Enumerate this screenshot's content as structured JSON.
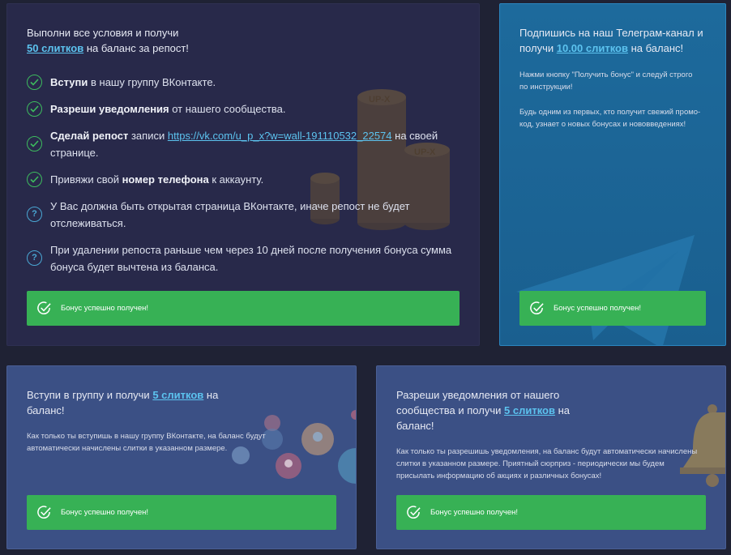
{
  "main": {
    "head_pre": "Выполни все условия и получи",
    "head_link": "50 слитков",
    "head_post": "на баланс за репост!",
    "coin_label_1": "UP-X",
    "coin_label_2": "UP-X",
    "items": [
      {
        "bold": "Вступи",
        "text": " в нашу группу ВКонтакте."
      },
      {
        "bold": "Разреши уведомления",
        "text": " от нашего сообщества."
      },
      {
        "bold": "Сделай репост",
        "text_pre": " записи ",
        "link": "https://vk.com/u_p_x?w=wall-191110532_22574",
        "text_post": " на своей странице."
      },
      {
        "pre": "Привяжи свой ",
        "bold": "номер телефона",
        "text": " к аккаунту."
      },
      {
        "text": "У Вас должна быть открытая страница ВКонтакте, иначе репост не будет отслеживаться."
      },
      {
        "text": "При удалении репоста раньше чем через 10 дней после получения бонуса сумма бонуса будет вычтена из баланса."
      }
    ],
    "button": "Бонус успешно получен!"
  },
  "telegram": {
    "head_pre": "Подпишись на наш Телеграм-канал и получи",
    "head_link": "10.00 слитков",
    "head_post": "на баланс!",
    "p1": "Нажми кнопку \"Получить бонус\" и следуй строго по инструкции!",
    "p2": "Будь одним из первых, кто получит свежий промо-код, узнает о новых бонусах и нововведениях!",
    "button": "Бонус успешно получен!"
  },
  "group": {
    "head_pre": "Вступи в группу и получи",
    "head_link": "5 слитков",
    "head_post": "на баланс!",
    "p": "Как только ты вступишь в нашу группу ВКонтакте, на баланс будут автоматически начислены слитки в указанном размере.",
    "button": "Бонус успешно получен!"
  },
  "notify": {
    "head_pre": "Разреши уведомления от нашего сообщества и получи",
    "head_link": "5 слитков",
    "head_post": "на баланс!",
    "p": "Как только ты разрешишь уведомления, на баланс будут автоматически начислены слитки в указанном размере. Приятный сюрприз - периодически мы будем присылать информацию об акциях и различных бонусах!",
    "button": "Бонус успешно получен!"
  },
  "colors": {
    "page_bg": "#1f2234",
    "main_card": "#28294a",
    "tg_card": "#1d6a9c",
    "small_card": "#3b5085",
    "button_green": "#37b155",
    "link": "#5cc3ef"
  }
}
